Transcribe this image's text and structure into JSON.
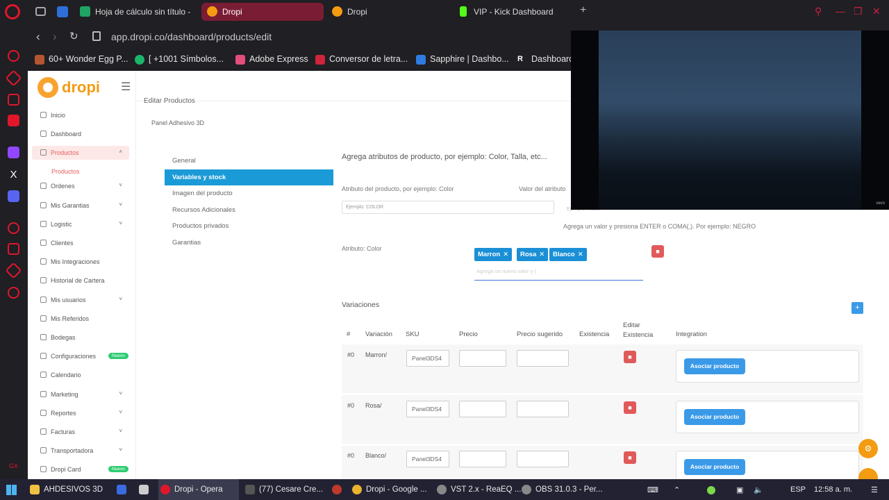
{
  "browser": {
    "tabs": [
      {
        "label": "Hoja de cálculo sin título - ",
        "active": false
      },
      {
        "label": "Dropi",
        "active": true
      },
      {
        "label": "Dropi",
        "active": false
      },
      {
        "label": "VIP - Kick Dashboard",
        "active": false
      }
    ],
    "url": "app.dropi.co/dashboard/products/edit",
    "bookmarks": [
      "60+ Wonder Egg P...",
      "[ +1001 Símbolos...",
      "Adobe Express",
      "Conversor de letra...",
      "Sapphire | Dashbo...",
      "Dashboard"
    ]
  },
  "app": {
    "logo_text": "dropi",
    "sidebar": [
      {
        "label": "Inicio",
        "chevron": false
      },
      {
        "label": "Dashboard",
        "chevron": false
      },
      {
        "label": "Productos",
        "chevron": true,
        "active": true
      },
      {
        "label": "Ordenes",
        "chevron": true
      },
      {
        "label": "Mis Garantias",
        "chevron": true
      },
      {
        "label": "Logistic",
        "chevron": true
      },
      {
        "label": "Clientes",
        "chevron": false
      },
      {
        "label": "Mis Integraciones",
        "chevron": false
      },
      {
        "label": "Historial de Cartera",
        "chevron": false
      },
      {
        "label": "Mis usuarios",
        "chevron": true
      },
      {
        "label": "Mis Referidos",
        "chevron": false
      },
      {
        "label": "Bodegas",
        "chevron": false
      },
      {
        "label": "Configuraciones",
        "chevron": false,
        "badge": "Nuevo"
      },
      {
        "label": "Calendario",
        "chevron": false
      },
      {
        "label": "Marketing",
        "chevron": true
      },
      {
        "label": "Reportes",
        "chevron": true
      },
      {
        "label": "Facturas",
        "chevron": true
      },
      {
        "label": "Transportadora",
        "chevron": true
      },
      {
        "label": "Dropi Card",
        "chevron": false,
        "badge": "Nuevo"
      }
    ],
    "sidebar_sub": "Productos",
    "breadcrumb": "Editar Productos",
    "product_name": "Panel Adhesivo 3D",
    "left_tabs": [
      "General",
      "Variables y stock",
      "Imagen del producto",
      "Recursos Adicionales",
      "Productos privados",
      "Garantias"
    ],
    "heading": "Agrega atributos de producto, por ejemplo: Color, Talla, etc...",
    "attr_label": "Atributo del producto, por ejemplo: Color",
    "value_label": "Valor del atributo",
    "attr_placeholder": "Ejemplo: COLOR",
    "value_placeholder": "Ejemplo: ROJO",
    "value_hint": "Agrega un valor y presiona ENTER o COMA(,). Por ejemplo: NEGRO",
    "attribute_row_label": "Atributo: Color",
    "chips": [
      "Marron",
      "Rosa",
      "Blanco"
    ],
    "chip_input_placeholder": "Agrega un nuevo valor y |",
    "variations_title": "Variaciones",
    "table_headers": {
      "num": "#",
      "variation": "Variación",
      "sku": "SKU",
      "price": "Precio",
      "suggested": "Precio sugerido",
      "stock": "Existencia",
      "edit_stock": "Editar Existencia",
      "integration": "Integration"
    },
    "rows": [
      {
        "num": "#0",
        "variation": "Marron/",
        "sku": "Panel3DS4"
      },
      {
        "num": "#0",
        "variation": "Rosa/",
        "sku": "Panel3DS4"
      },
      {
        "num": "#0",
        "variation": "Blanco/",
        "sku": "Panel3DS4"
      }
    ],
    "associate_label": "Asociar producto"
  },
  "video": {
    "watermark": "vevo"
  },
  "taskbar": {
    "items": [
      "AHDESIVOS 3D",
      "Dropi - Opera",
      "(77) Cesare Cre...",
      "Dropi - Google ...",
      "VST 2.x - ReaEQ ...",
      "OBS 31.0.3 - Per..."
    ],
    "lang": "ESP",
    "time": "12:58 a. m."
  }
}
